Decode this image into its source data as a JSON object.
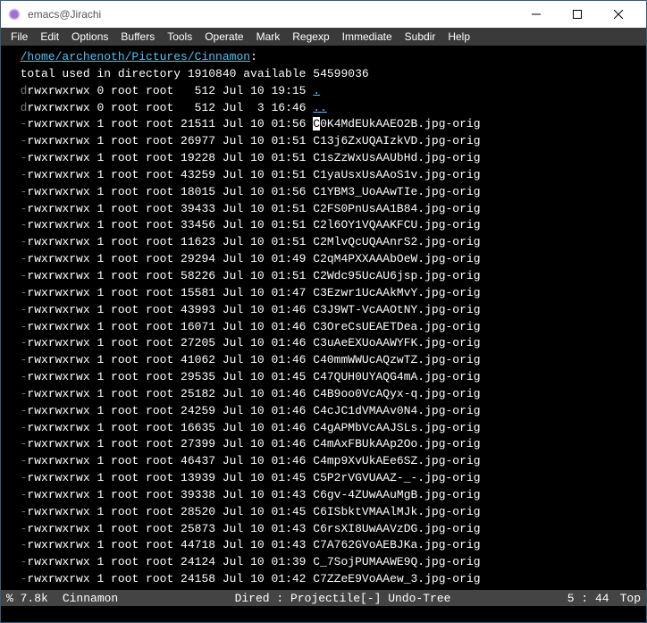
{
  "window": {
    "title": "emacs@Jirachi"
  },
  "menubar": [
    "File",
    "Edit",
    "Options",
    "Buffers",
    "Tools",
    "Operate",
    "Mark",
    "Regexp",
    "Immediate",
    "Subdir",
    "Help"
  ],
  "dired": {
    "path": "/home/archenoth/Pictures/Cinnamon",
    "total_line": "total used in directory 1910840 available 54599036",
    "cursor_char": "C",
    "rows": [
      {
        "perms": "drwxrwxrwx",
        "links": "0",
        "owner": "root",
        "group": "root",
        "size": "512",
        "date": "Jul 10 19:15",
        "name": ".",
        "is_dir": true
      },
      {
        "perms": "drwxrwxrwx",
        "links": "0",
        "owner": "root",
        "group": "root",
        "size": "512",
        "date": "Jul  3 16:46",
        "name": "..",
        "is_dir": true
      },
      {
        "perms": "-rwxrwxrwx",
        "links": "1",
        "owner": "root",
        "group": "root",
        "size": "21511",
        "date": "Jul 10 01:56",
        "name": "C0K4MdEUkAAEO2B.jpg-orig",
        "cursor": true
      },
      {
        "perms": "-rwxrwxrwx",
        "links": "1",
        "owner": "root",
        "group": "root",
        "size": "26977",
        "date": "Jul 10 01:51",
        "name": "C13j6ZxUQAIzkVD.jpg-orig"
      },
      {
        "perms": "-rwxrwxrwx",
        "links": "1",
        "owner": "root",
        "group": "root",
        "size": "19228",
        "date": "Jul 10 01:51",
        "name": "C1sZzWxUsAAUbHd.jpg-orig"
      },
      {
        "perms": "-rwxrwxrwx",
        "links": "1",
        "owner": "root",
        "group": "root",
        "size": "43259",
        "date": "Jul 10 01:51",
        "name": "C1yaUsxUsAAoS1v.jpg-orig"
      },
      {
        "perms": "-rwxrwxrwx",
        "links": "1",
        "owner": "root",
        "group": "root",
        "size": "18015",
        "date": "Jul 10 01:56",
        "name": "C1YBM3_UoAAwTIe.jpg-orig"
      },
      {
        "perms": "-rwxrwxrwx",
        "links": "1",
        "owner": "root",
        "group": "root",
        "size": "39433",
        "date": "Jul 10 01:51",
        "name": "C2FS0PnUsAA1B84.jpg-orig"
      },
      {
        "perms": "-rwxrwxrwx",
        "links": "1",
        "owner": "root",
        "group": "root",
        "size": "33456",
        "date": "Jul 10 01:51",
        "name": "C2l6OY1VQAAKFCU.jpg-orig"
      },
      {
        "perms": "-rwxrwxrwx",
        "links": "1",
        "owner": "root",
        "group": "root",
        "size": "11623",
        "date": "Jul 10 01:51",
        "name": "C2MlvQcUQAAnrS2.jpg-orig"
      },
      {
        "perms": "-rwxrwxrwx",
        "links": "1",
        "owner": "root",
        "group": "root",
        "size": "29294",
        "date": "Jul 10 01:49",
        "name": "C2qM4PXXAAAbOeW.jpg-orig"
      },
      {
        "perms": "-rwxrwxrwx",
        "links": "1",
        "owner": "root",
        "group": "root",
        "size": "58226",
        "date": "Jul 10 01:51",
        "name": "C2Wdc95UcAU6jsp.jpg-orig"
      },
      {
        "perms": "-rwxrwxrwx",
        "links": "1",
        "owner": "root",
        "group": "root",
        "size": "15581",
        "date": "Jul 10 01:47",
        "name": "C3Ezwr1UcAAkMvY.jpg-orig"
      },
      {
        "perms": "-rwxrwxrwx",
        "links": "1",
        "owner": "root",
        "group": "root",
        "size": "43993",
        "date": "Jul 10 01:46",
        "name": "C3J9WT-VcAAOtNY.jpg-orig"
      },
      {
        "perms": "-rwxrwxrwx",
        "links": "1",
        "owner": "root",
        "group": "root",
        "size": "16071",
        "date": "Jul 10 01:46",
        "name": "C3OreCsUEAETDea.jpg-orig"
      },
      {
        "perms": "-rwxrwxrwx",
        "links": "1",
        "owner": "root",
        "group": "root",
        "size": "27205",
        "date": "Jul 10 01:46",
        "name": "C3uAeEXUoAAWYFK.jpg-orig"
      },
      {
        "perms": "-rwxrwxrwx",
        "links": "1",
        "owner": "root",
        "group": "root",
        "size": "41062",
        "date": "Jul 10 01:46",
        "name": "C40mmWWUcAQzwTZ.jpg-orig"
      },
      {
        "perms": "-rwxrwxrwx",
        "links": "1",
        "owner": "root",
        "group": "root",
        "size": "29535",
        "date": "Jul 10 01:45",
        "name": "C47QUH0UYAQG4mA.jpg-orig"
      },
      {
        "perms": "-rwxrwxrwx",
        "links": "1",
        "owner": "root",
        "group": "root",
        "size": "25182",
        "date": "Jul 10 01:46",
        "name": "C4B9oo0VcAQyx-q.jpg-orig"
      },
      {
        "perms": "-rwxrwxrwx",
        "links": "1",
        "owner": "root",
        "group": "root",
        "size": "24259",
        "date": "Jul 10 01:46",
        "name": "C4cJC1dVMAAv0N4.jpg-orig"
      },
      {
        "perms": "-rwxrwxrwx",
        "links": "1",
        "owner": "root",
        "group": "root",
        "size": "16635",
        "date": "Jul 10 01:46",
        "name": "C4gAPMbVcAAJSLs.jpg-orig"
      },
      {
        "perms": "-rwxrwxrwx",
        "links": "1",
        "owner": "root",
        "group": "root",
        "size": "27399",
        "date": "Jul 10 01:46",
        "name": "C4mAxFBUkAAp2Oo.jpg-orig"
      },
      {
        "perms": "-rwxrwxrwx",
        "links": "1",
        "owner": "root",
        "group": "root",
        "size": "46437",
        "date": "Jul 10 01:46",
        "name": "C4mp9XvUkAEe6SZ.jpg-orig"
      },
      {
        "perms": "-rwxrwxrwx",
        "links": "1",
        "owner": "root",
        "group": "root",
        "size": "13939",
        "date": "Jul 10 01:45",
        "name": "C5P2rVGVUAAZ-_-.jpg-orig"
      },
      {
        "perms": "-rwxrwxrwx",
        "links": "1",
        "owner": "root",
        "group": "root",
        "size": "39338",
        "date": "Jul 10 01:43",
        "name": "C6gv-4ZUwAAuMgB.jpg-orig"
      },
      {
        "perms": "-rwxrwxrwx",
        "links": "1",
        "owner": "root",
        "group": "root",
        "size": "28520",
        "date": "Jul 10 01:45",
        "name": "C6ISbktVMAAlMJk.jpg-orig"
      },
      {
        "perms": "-rwxrwxrwx",
        "links": "1",
        "owner": "root",
        "group": "root",
        "size": "25873",
        "date": "Jul 10 01:43",
        "name": "C6rsXI8UwAAVzDG.jpg-orig"
      },
      {
        "perms": "-rwxrwxrwx",
        "links": "1",
        "owner": "root",
        "group": "root",
        "size": "44718",
        "date": "Jul 10 01:43",
        "name": "C7A762GVoAEBJKa.jpg-orig"
      },
      {
        "perms": "-rwxrwxrwx",
        "links": "1",
        "owner": "root",
        "group": "root",
        "size": "24124",
        "date": "Jul 10 01:39",
        "name": "C_7SojPUMAAWE9Q.jpg-orig"
      },
      {
        "perms": "-rwxrwxrwx",
        "links": "1",
        "owner": "root",
        "group": "root",
        "size": "24158",
        "date": "Jul 10 01:42",
        "name": "C7ZZeE9VoAAew_3.jpg-orig"
      }
    ]
  },
  "modeline": {
    "pct": "% 7.8k",
    "buffer": "Cinnamon",
    "mode": "Dired : Projectile[-] Undo-Tree",
    "pos": "5 : 44",
    "scroll": "Top"
  }
}
